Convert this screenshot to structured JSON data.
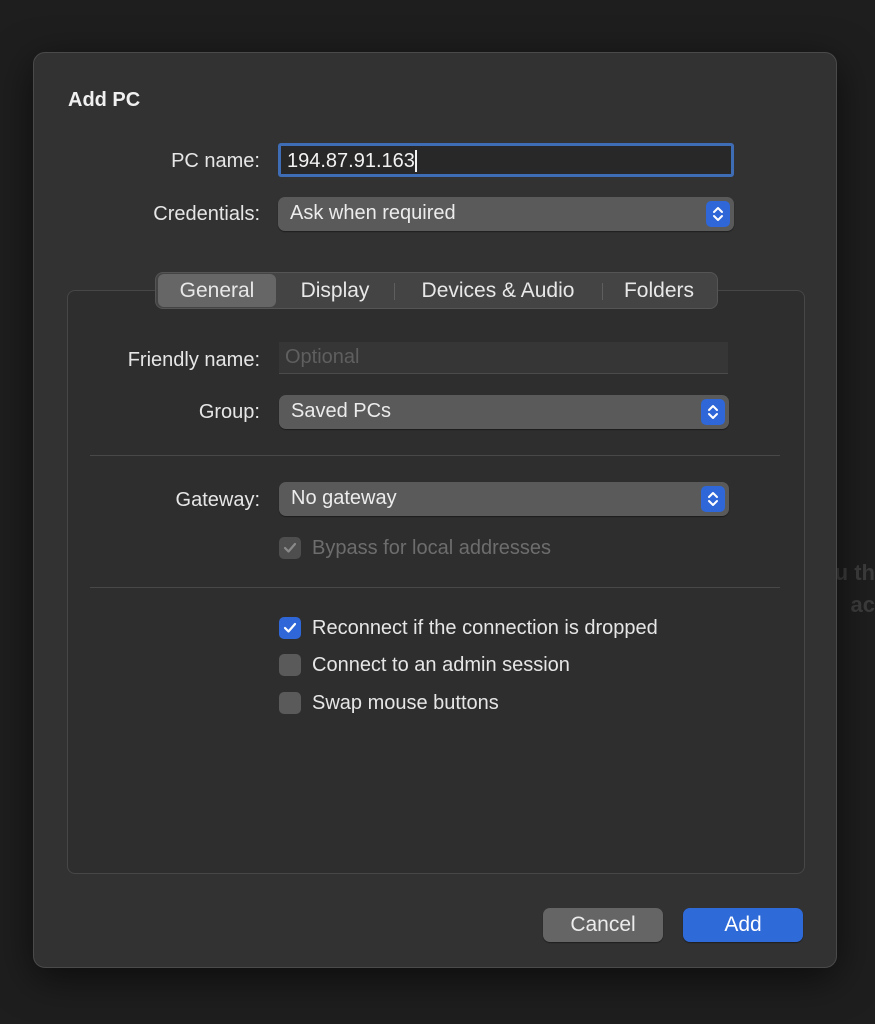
{
  "background": {
    "partial_text_1": "u th",
    "partial_text_2": "ac"
  },
  "dialog": {
    "title": "Add PC",
    "pc_name": {
      "label": "PC name:",
      "value": "194.87.91.163"
    },
    "credentials": {
      "label": "Credentials:",
      "value": "Ask when required"
    },
    "tabs": [
      "General",
      "Display",
      "Devices & Audio",
      "Folders"
    ],
    "active_tab": "General",
    "general": {
      "friendly_name": {
        "label": "Friendly name:",
        "placeholder": "Optional"
      },
      "group": {
        "label": "Group:",
        "value": "Saved PCs"
      },
      "gateway": {
        "label": "Gateway:",
        "value": "No gateway"
      },
      "bypass": {
        "label": "Bypass for local addresses",
        "checked": true,
        "enabled": false
      },
      "options": [
        {
          "label": "Reconnect if the connection is dropped",
          "checked": true
        },
        {
          "label": "Connect to an admin session",
          "checked": false
        },
        {
          "label": "Swap mouse buttons",
          "checked": false
        }
      ]
    },
    "buttons": {
      "cancel": "Cancel",
      "add": "Add"
    }
  },
  "colors": {
    "accent": "#2f67d8",
    "focus_ring": "#3f6db5",
    "dialog_bg": "#323232"
  },
  "icons": {
    "popup_stepper": "up-down-chevron-icon",
    "checkmark": "checkmark-icon"
  }
}
